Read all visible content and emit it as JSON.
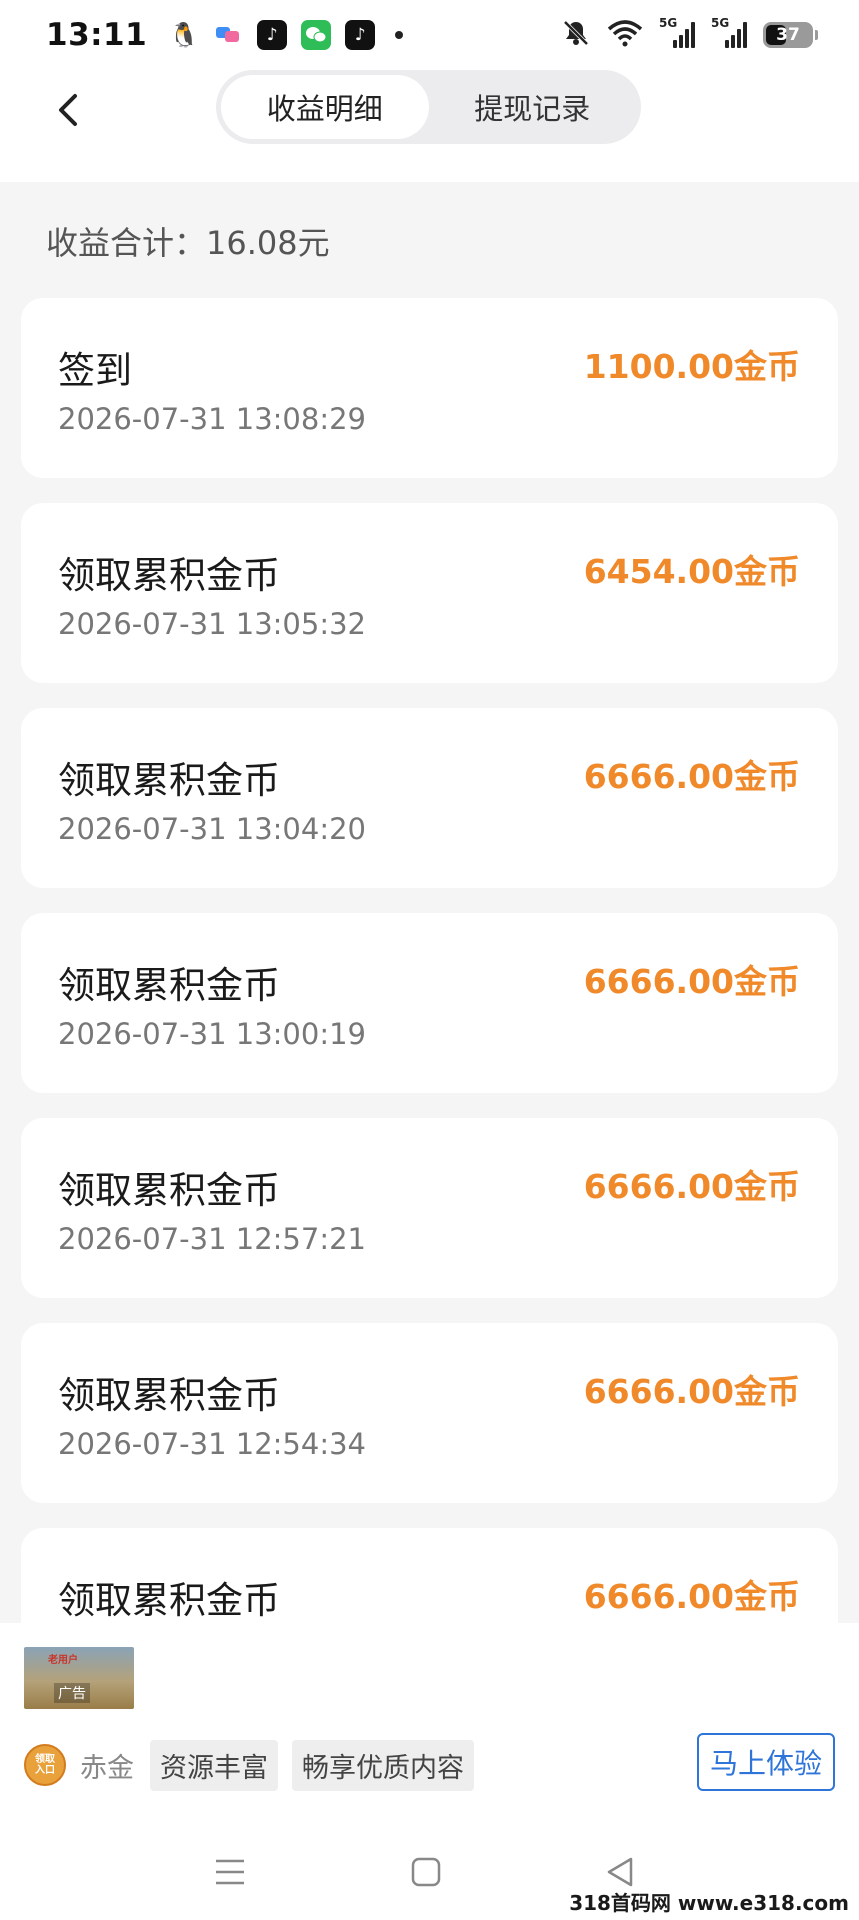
{
  "status_bar": {
    "time": "13:11",
    "notification_icons": [
      "qq-icon",
      "im-icon",
      "tiktok-icon",
      "wechat-icon",
      "tiktok-icon"
    ],
    "signal_labels": [
      "5G",
      "5G"
    ],
    "battery": "37"
  },
  "header": {
    "tabs": [
      {
        "label": "收益明细",
        "active": true
      },
      {
        "label": "提现记录",
        "active": false
      }
    ]
  },
  "summary": {
    "label": "收益合计：",
    "value": "16.08元"
  },
  "records": [
    {
      "title": "签到",
      "time": "2026-07-31 13:08:29",
      "amount": "1100.00",
      "unit": "金币"
    },
    {
      "title": "领取累积金币",
      "time": "2026-07-31 13:05:32",
      "amount": "6454.00",
      "unit": "金币"
    },
    {
      "title": "领取累积金币",
      "time": "2026-07-31 13:04:20",
      "amount": "6666.00",
      "unit": "金币"
    },
    {
      "title": "领取累积金币",
      "time": "2026-07-31 13:00:19",
      "amount": "6666.00",
      "unit": "金币"
    },
    {
      "title": "领取累积金币",
      "time": "2026-07-31 12:57:21",
      "amount": "6666.00",
      "unit": "金币"
    },
    {
      "title": "领取累积金币",
      "time": "2026-07-31 12:54:34",
      "amount": "6666.00",
      "unit": "金币"
    },
    {
      "title": "领取累积金币",
      "time": "",
      "amount": "6666.00",
      "unit": "金币"
    }
  ],
  "ad": {
    "image_text": "老用户",
    "tag": "广告",
    "logo_text": "领取入口",
    "brand": "赤金",
    "chips": [
      "资源丰富",
      "畅享优质内容"
    ],
    "cta": "马上体验"
  },
  "watermark": "318首码网 www.e318.com",
  "colors": {
    "amount": "#f0892a",
    "cta": "#2e74d9",
    "background": "#f5f5f5"
  }
}
